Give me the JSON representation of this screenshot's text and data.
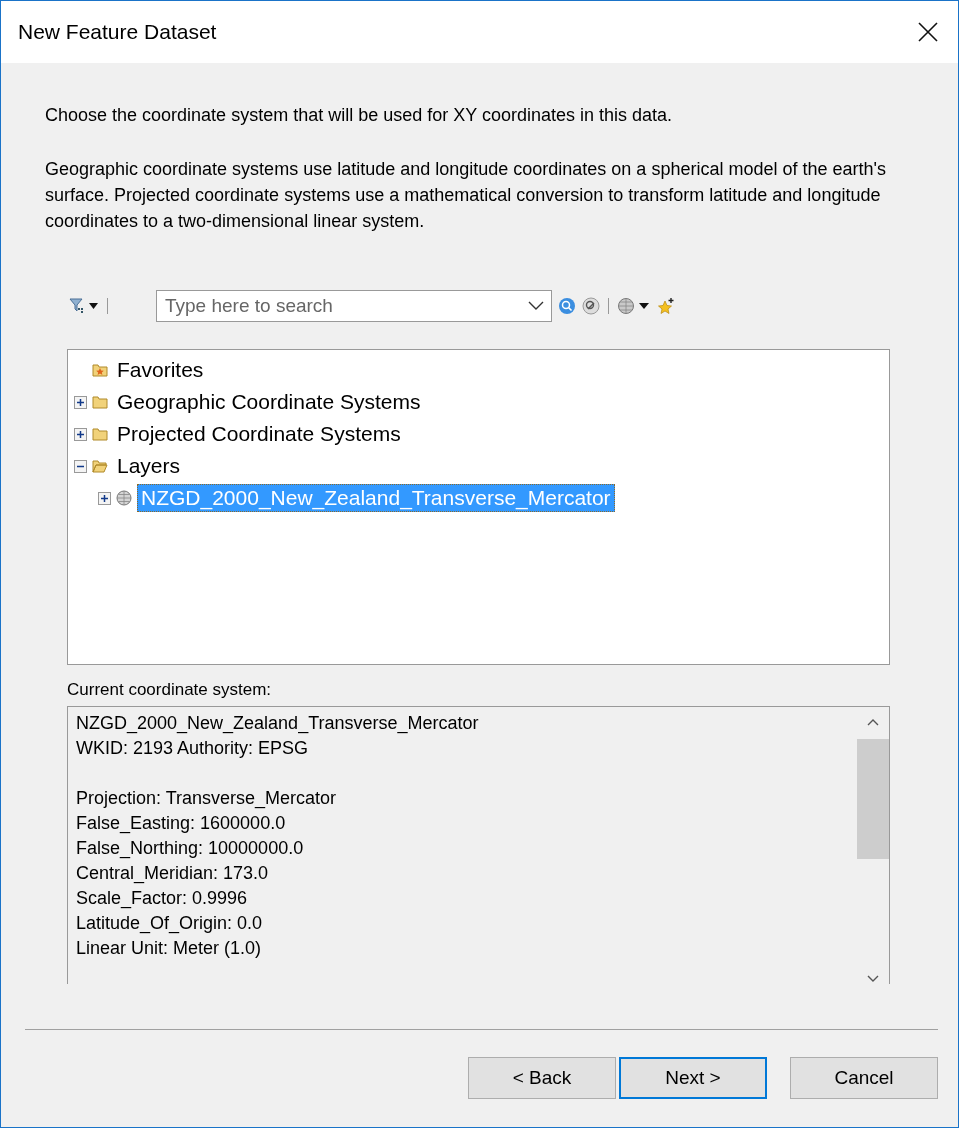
{
  "window": {
    "title": "New Feature Dataset"
  },
  "intro": "Choose the coordinate system that will be used for XY coordinates in this data.",
  "description": "Geographic coordinate systems use latitude and longitude coordinates on a spherical model of the earth's surface. Projected coordinate systems use a mathematical conversion to transform latitude and longitude coordinates to a two-dimensional linear system.",
  "search": {
    "placeholder": "Type here to search"
  },
  "tree": [
    {
      "label": "Favorites",
      "kind": "favorites",
      "selected": false
    },
    {
      "label": "Geographic Coordinate Systems",
      "kind": "folder",
      "expanded": false,
      "selected": false
    },
    {
      "label": "Projected Coordinate Systems",
      "kind": "folder",
      "expanded": false,
      "selected": false
    },
    {
      "label": "Layers",
      "kind": "folder",
      "expanded": true,
      "selected": false,
      "children": [
        {
          "label": "NZGD_2000_New_Zealand_Transverse_Mercator",
          "kind": "projection",
          "expanded": false,
          "selected": true
        }
      ]
    }
  ],
  "current_label": "Current coordinate system:",
  "details": [
    [
      "NZGD_2000_New_Zealand_Transverse_Mercator",
      "WKID: 2193 Authority: EPSG"
    ],
    [
      "Projection: Transverse_Mercator",
      "False_Easting: 1600000.0",
      "False_Northing: 10000000.0",
      "Central_Meridian: 173.0",
      "Scale_Factor: 0.9996",
      "Latitude_Of_Origin: 0.0",
      "Linear Unit: Meter (1.0)"
    ]
  ],
  "buttons": [
    {
      "label": "< Back",
      "default": false
    },
    {
      "label": "Next >",
      "default": true
    },
    {
      "label": "Cancel",
      "default": false
    }
  ]
}
